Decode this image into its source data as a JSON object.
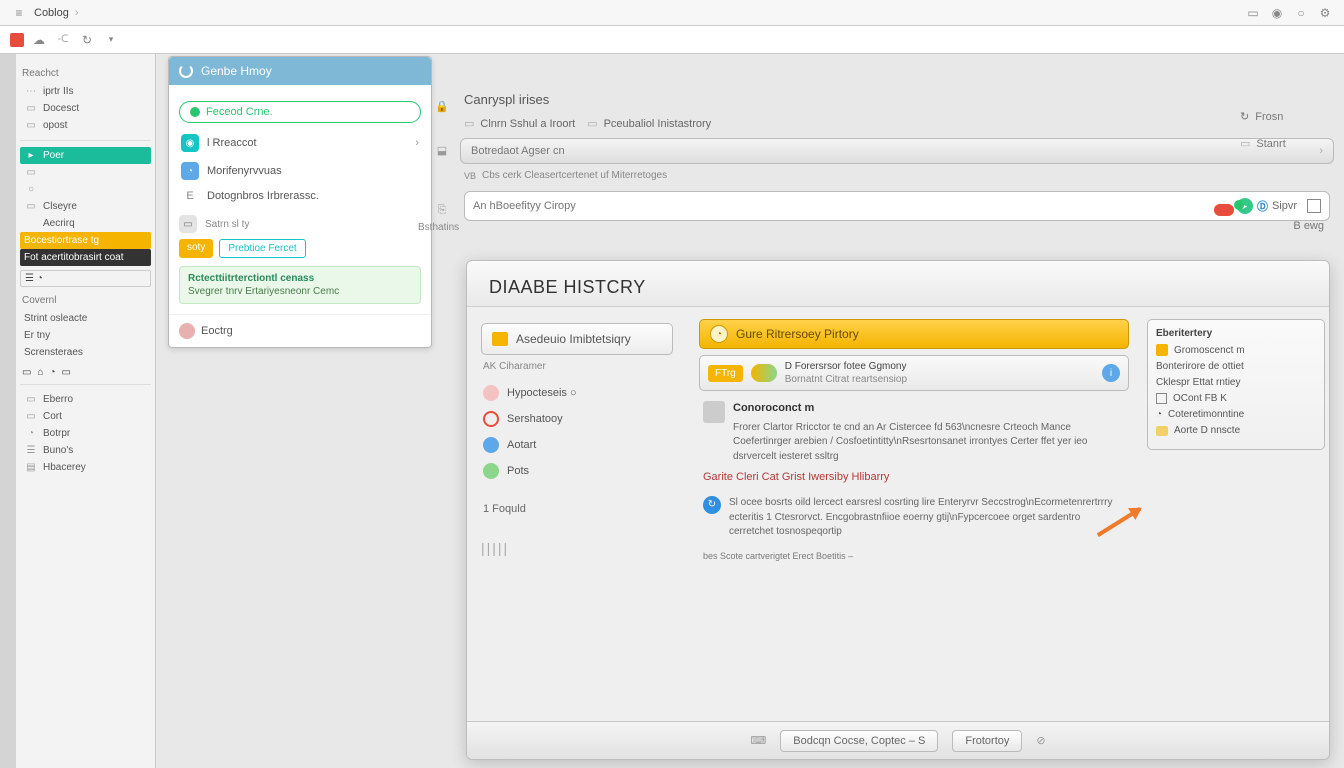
{
  "topbar": {
    "title": "Coblog",
    "arrow": "›"
  },
  "leftbar": {
    "section1": "Reachct",
    "items1": [
      {
        "icon": "⋯",
        "label": "iprtr IIs"
      },
      {
        "icon": "▭",
        "label": "Docesct"
      },
      {
        "icon": "▭",
        "label": "opost"
      }
    ],
    "tealItem": "Poer",
    "items2": [
      {
        "icon": "▭",
        "label": ""
      },
      {
        "icon": "○",
        "label": ""
      },
      {
        "icon": "▭",
        "label": "Clseyre"
      },
      {
        "icon": "",
        "label": "Aecrirq"
      }
    ],
    "yellowItem": "Bocestiortrase tg",
    "darkItem": "Fot acertitobrasirt coat",
    "box1": "☰  ◔",
    "section2": "Covernl",
    "items3": [
      {
        "label": "Strint osleacte"
      },
      {
        "label": "Er tny"
      },
      {
        "label": "Scrensteraes"
      }
    ],
    "icons_row": [
      "▭",
      "⌂",
      "◔",
      "▭"
    ],
    "items4": [
      {
        "icon": "▭",
        "label": "Eberro"
      },
      {
        "icon": "▭",
        "label": "Cort"
      },
      {
        "icon": "◔",
        "label": "Botrpr"
      },
      {
        "icon": "☰",
        "label": "Buno's"
      },
      {
        "icon": "▤",
        "label": "Hbacerey"
      }
    ]
  },
  "bluepanel": {
    "title": "Genbe Hmoy",
    "green_pill": "Feceod Crne.",
    "items": [
      {
        "cls": "c-teal",
        "icon": "◉",
        "label": "l Rreaccot",
        "arrow": "›"
      },
      {
        "cls": "c-blue",
        "icon": "◔",
        "label": "Morifenyrvvuas"
      },
      {
        "cls": "",
        "icon": "E",
        "label": "Dotognbros Irbrerassc."
      }
    ],
    "tag_l": "Satrn sl ty",
    "tags": [
      "soty",
      "Prebtioe Fercet"
    ],
    "note_title": "Rctecttiitrterctiontl cenass",
    "note_body": "Svegrer tnrv Ertariyesneonr Cemc",
    "foot_label": "Eoctrg"
  },
  "content": {
    "page_title": "Canryspl irises",
    "crumb_a": "Clnrn Sshul a Iroort",
    "crumb_b": "Pceubaliol Inistastrory",
    "bar_text": "Botredaot Agser cn",
    "label_under": "Cbs cerk Cleasertcertenet uf Miterretoges",
    "search_placeholder": "An hBoeefityy Ciropy",
    "search_go": "Sipvr",
    "left_side": "Bsthatins"
  },
  "rcol": {
    "item1": "Frosn",
    "item2": "Stanrt",
    "item3": "B ewg"
  },
  "dialog": {
    "title": "DIAABE HISTCRY",
    "nav_btn": "Asedeuio Imibtetsiqry",
    "nav_sub": "AK Ciharamer",
    "opts": [
      {
        "cls": "bub-pink",
        "label": "Hypocteseis ○"
      },
      {
        "cls": "bub-red-out",
        "label": "Sershatooy"
      },
      {
        "cls": "bub-blue",
        "label": "Aotart"
      },
      {
        "cls": "bub-green",
        "label": "Pots"
      }
    ],
    "opt_last": "1  Foquld",
    "gold_bar": "Gure Ritrersoey Pirtory",
    "row_tag": "FTrg",
    "row_t1": "D Forersrsor fotee Ggmony",
    "row_t2": "Bornatnt Citrat reartsensiop",
    "desc_head": "Conoroconct m",
    "desc_lines": "Frorer Clartor Rricctor te cnd an Ar Cistercee fd 563\\ncnesre Crteoch Mance Coefertinrger arebien / Cosfoetintitty\\nRsesrtonsanet irrontyes Certer ffet yer ieo dsrvercelt iesteret ssltrg",
    "warn": "Garite Cleri Cat Grist Iwersiby Hlibarry",
    "info": "Sl ocee bosrts oild lercect earsresl cosrting lire Enteryrvr Seccstrog\\nEcormetenrertrrry ecteritis 1 Ctesrorvct. Encgobrastnfiioe eoerny gtij\\nFypcercoee orget sardentro cerretchet tosnospeqortip",
    "link": "bes Scote cartverigtet Erect Boetitis –",
    "side_h": "Eberitertery",
    "side_lines": [
      {
        "icon": "▭",
        "txt": "Gromoscenct m"
      },
      {
        "icon": "",
        "txt": "Bonterirore de ottiet"
      },
      {
        "icon": "",
        "txt": "Cklespr Ettat rntiey"
      },
      {
        "chk": true,
        "txt": "OCont FB K"
      },
      {
        "icon": "◔",
        "txt": "Coteretimonntine"
      },
      {
        "icon": "▭",
        "txt": "Aorte D nnscte"
      }
    ],
    "foot_btn": "Bodcqn Cocse,  Coptec – S",
    "foot_btn2": "Frotortoy"
  }
}
